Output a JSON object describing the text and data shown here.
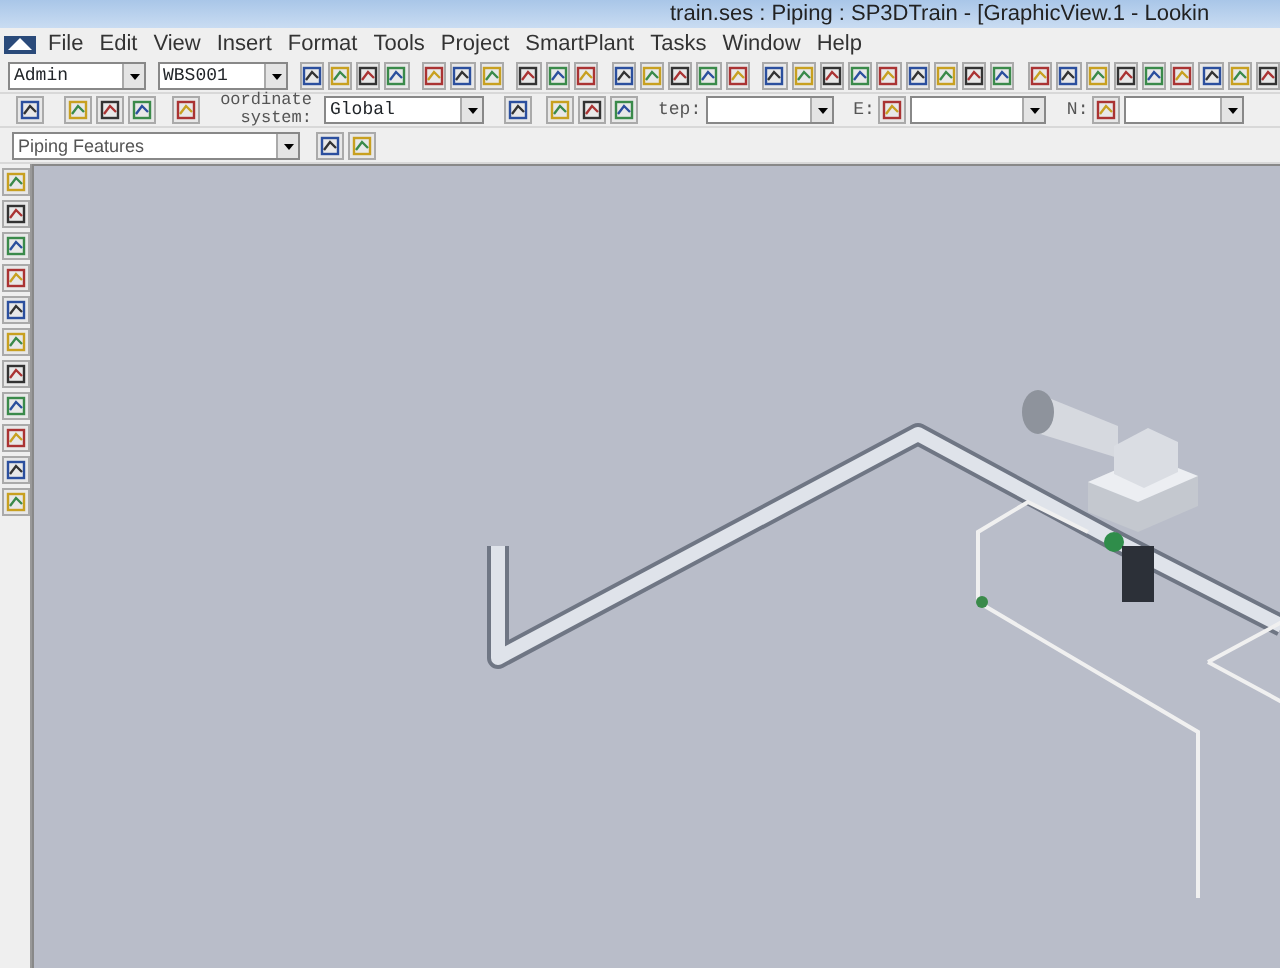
{
  "window": {
    "title": "train.ses : Piping : SP3DTrain - [GraphicView.1 - Lookin"
  },
  "menu": [
    "File",
    "Edit",
    "View",
    "Insert",
    "Format",
    "Tools",
    "Project",
    "SmartPlant",
    "Tasks",
    "Window",
    "Help"
  ],
  "toolbar_1": {
    "combos": [
      {
        "value": "Admin"
      },
      {
        "value": "WBS001"
      }
    ]
  },
  "toolbar_2": {
    "coordinate_label": "oordinate system:",
    "coordinate_system": {
      "value": "Global"
    },
    "step_label": "tep:",
    "e_label": "E:",
    "n_label": "N:"
  },
  "toolbar_3": {
    "task_combo": {
      "value": "Piping Features"
    }
  }
}
